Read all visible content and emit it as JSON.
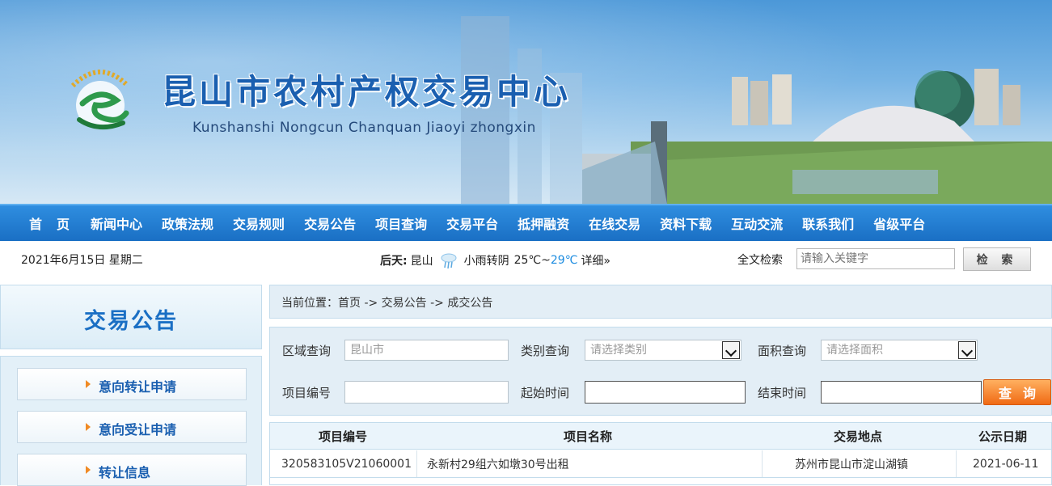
{
  "header": {
    "title": "昆山市农村产权交易中心",
    "subtitle": "Kunshanshi Nongcun Chanquan Jiaoyi zhongxin"
  },
  "nav": {
    "items": [
      "首页",
      "新闻中心",
      "政策法规",
      "交易规则",
      "交易公告",
      "项目查询",
      "交易平台",
      "抵押融资",
      "在线交易",
      "资料下载",
      "互动交流",
      "联系我们",
      "省级平台"
    ]
  },
  "infobar": {
    "date": "2021年6月15日 星期二",
    "weather_label": "后天:",
    "weather_city": "昆山",
    "weather_desc": "小雨转阴",
    "temp_low": "25℃~",
    "temp_high": "29℃",
    "weather_more": "详细»",
    "search_label": "全文检索",
    "search_placeholder": "请输入关键字",
    "search_button": "检 索"
  },
  "sidebar": {
    "heading": "交易公告",
    "items": [
      "意向转让申请",
      "意向受让申请",
      "转让信息"
    ]
  },
  "breadcrumb": "当前位置：首页 -> 交易公告 -> 成交公告",
  "filter": {
    "region_label": "区域查询",
    "region_value": "昆山市",
    "category_label": "类别查询",
    "category_placeholder": "请选择类别",
    "area_label": "面积查询",
    "area_placeholder": "请选择面积",
    "code_label": "项目编号",
    "start_label": "起始时间",
    "end_label": "结束时间",
    "query_button": "查询"
  },
  "table": {
    "headers": [
      "项目编号",
      "项目名称",
      "交易地点",
      "公示日期"
    ],
    "rows": [
      [
        "320583105V21060001",
        "永新村29组六如墩30号出租",
        "苏州市昆山市淀山湖镇",
        "2021-06-11"
      ]
    ]
  },
  "colors": {
    "nav_blue": "#1a6fc4",
    "title_blue": "#1a5fb0",
    "accent_orange": "#f06a14",
    "panel_bg": "#e3eef6"
  }
}
